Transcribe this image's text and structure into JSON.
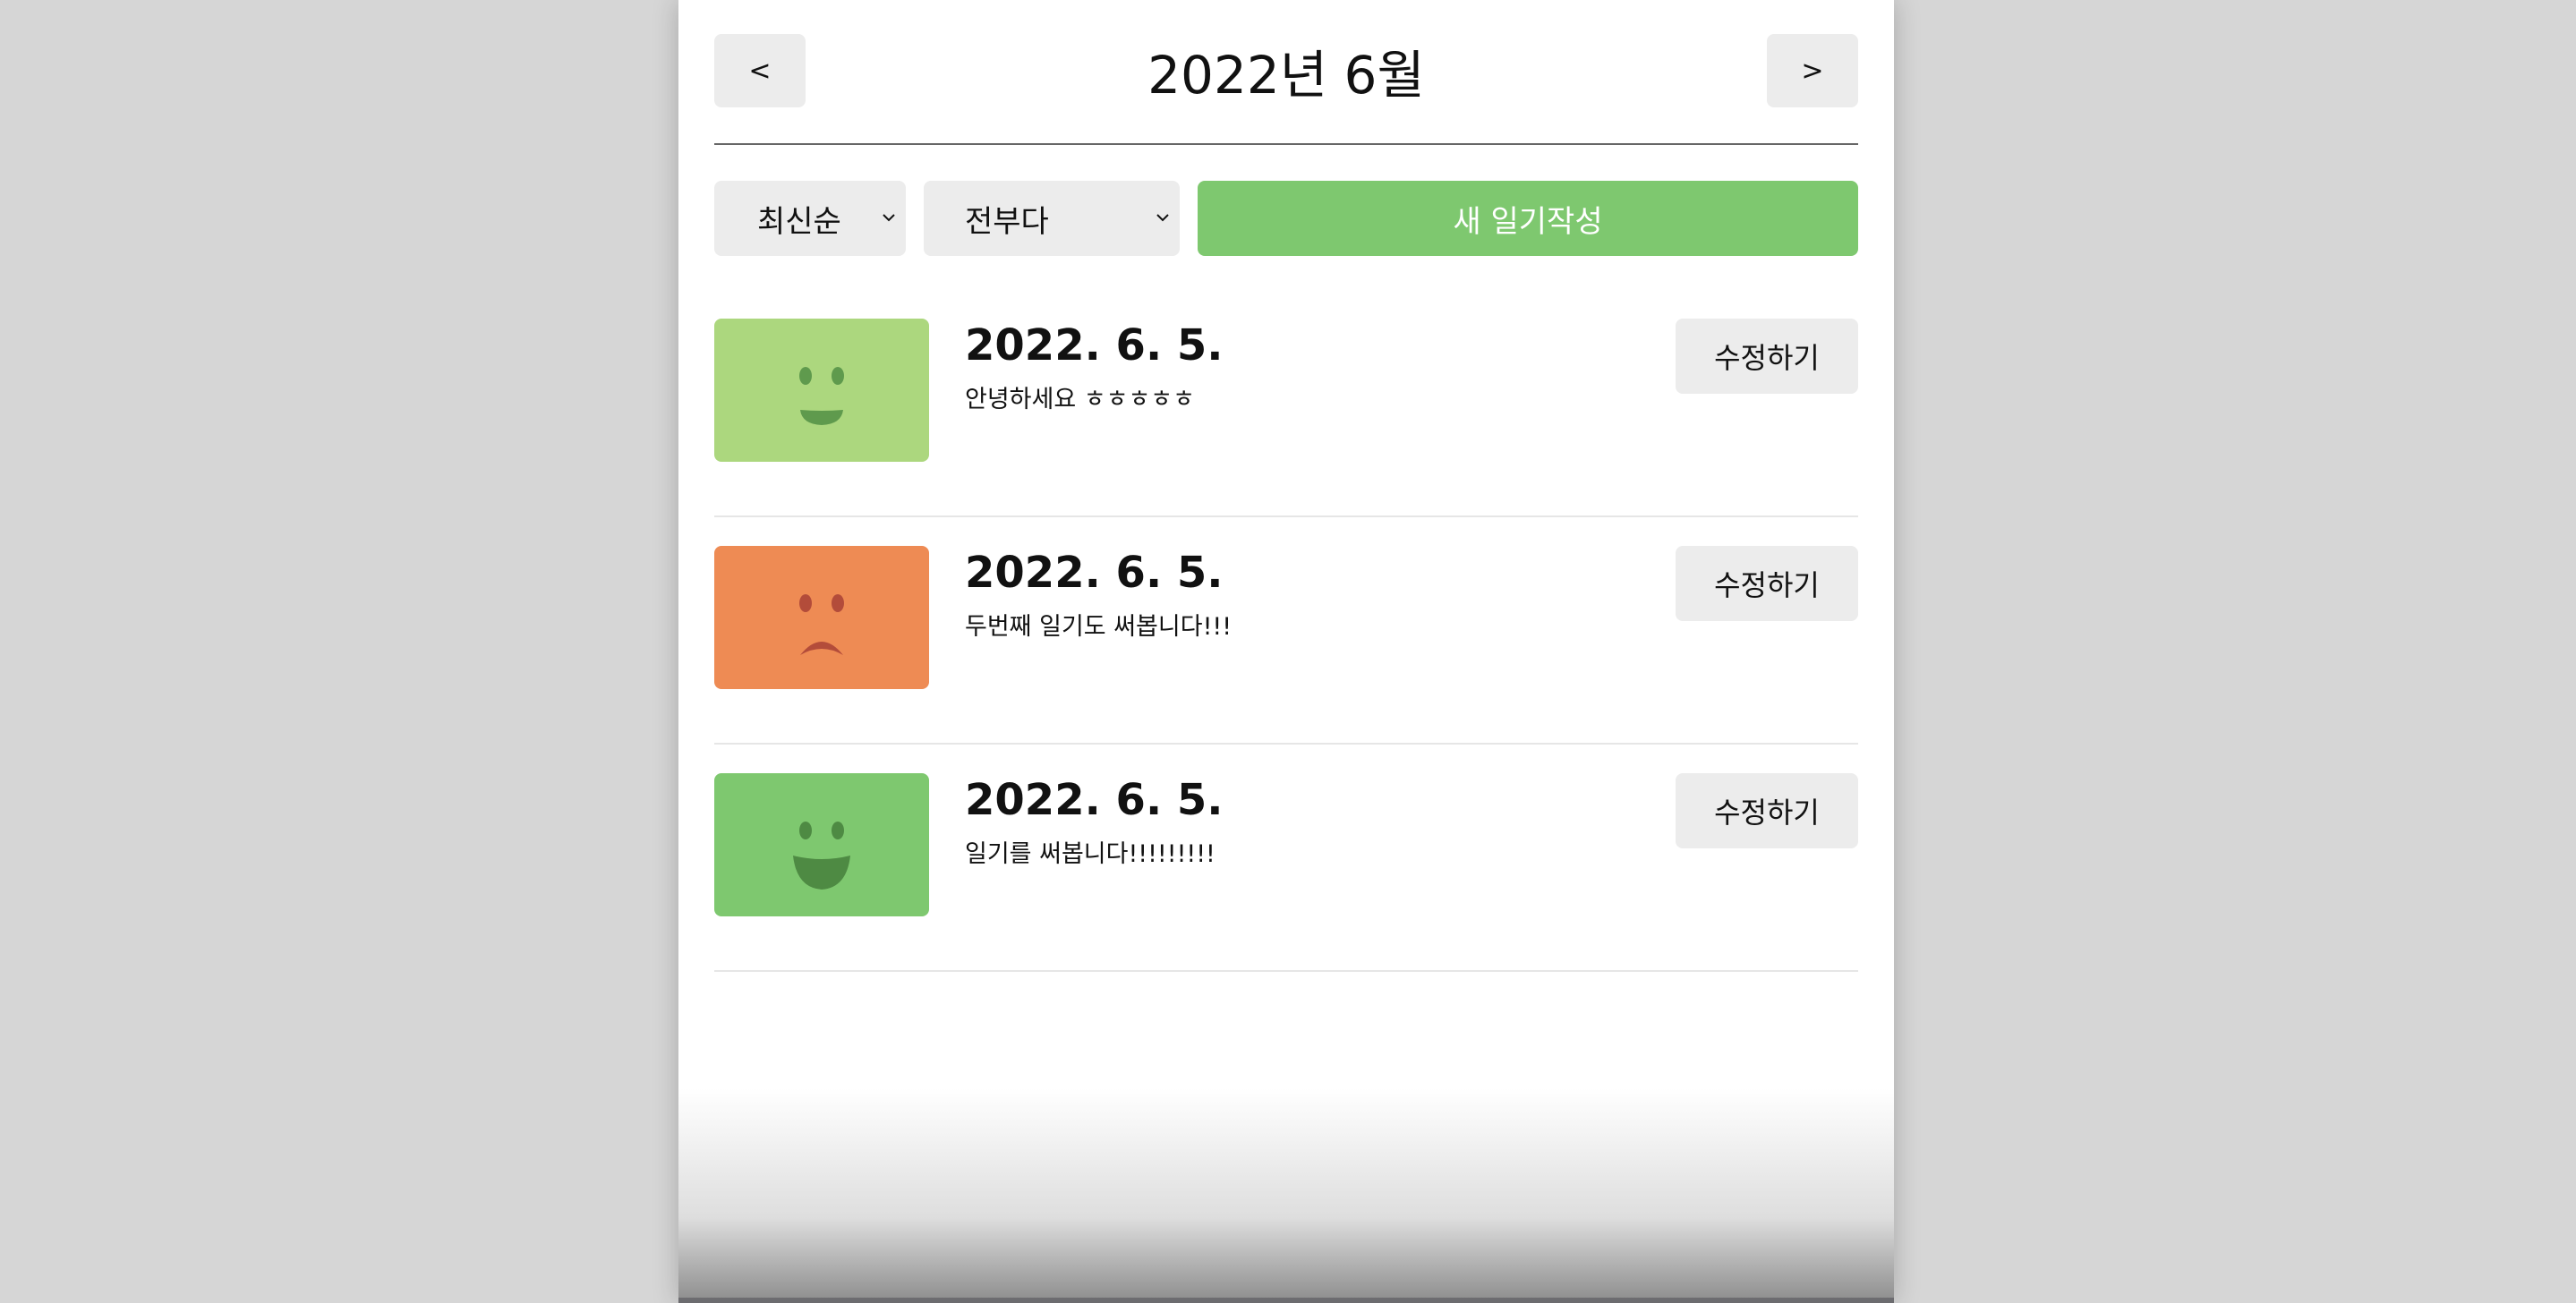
{
  "header": {
    "prev_label": "<",
    "next_label": ">",
    "title": "2022년 6월"
  },
  "menu": {
    "sort_value": "최신순",
    "filter_value": "전부다",
    "new_button_label": "새 일기작성"
  },
  "diaries": [
    {
      "date": "2022. 6. 5.",
      "content": "안녕하세요 ㅎㅎㅎㅎㅎ",
      "edit_label": "수정하기",
      "emotion_icon": "smile-icon",
      "emotion_color": "#acd77e"
    },
    {
      "date": "2022. 6. 5.",
      "content": "두번째 일기도 써봅니다!!!",
      "edit_label": "수정하기",
      "emotion_icon": "frown-icon",
      "emotion_color": "#ee8b54"
    },
    {
      "date": "2022. 6. 5.",
      "content": "일기를 써봅니다!!!!!!!!!",
      "edit_label": "수정하기",
      "emotion_icon": "laugh-icon",
      "emotion_color": "#7ec86f"
    }
  ],
  "colors": {
    "accent": "#7ec86f",
    "button_bg": "#ececec",
    "background": "#d6d6d6"
  }
}
